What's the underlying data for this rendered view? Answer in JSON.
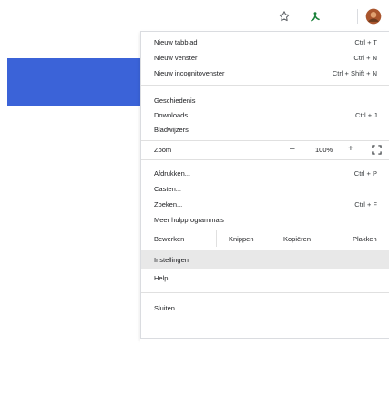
{
  "toolbar": {
    "star_icon": "star-icon",
    "extension_icon": "extension-icon",
    "avatar_icon": "avatar-icon"
  },
  "colors": {
    "accent": "#3b63d8",
    "highlight": "#e8e8e8"
  },
  "menu": {
    "new_tab": {
      "label": "Nieuw tabblad",
      "shortcut": "Ctrl + T"
    },
    "new_window": {
      "label": "Nieuw venster",
      "shortcut": "Ctrl + N"
    },
    "new_incognito": {
      "label": "Nieuw incognitovenster",
      "shortcut": "Ctrl + Shift + N"
    },
    "history": {
      "label": "Geschiedenis"
    },
    "downloads": {
      "label": "Downloads",
      "shortcut": "Ctrl + J"
    },
    "bookmarks": {
      "label": "Bladwijzers"
    },
    "zoom": {
      "label": "Zoom",
      "minus": "–",
      "value": "100%",
      "plus": "+"
    },
    "print": {
      "label": "Afdrukken...",
      "shortcut": "Ctrl + P"
    },
    "cast": {
      "label": "Casten..."
    },
    "find": {
      "label": "Zoeken...",
      "shortcut": "Ctrl + F"
    },
    "more_tools": {
      "label": "Meer hulpprogramma's"
    },
    "edit": {
      "label": "Bewerken",
      "cut": "Knippen",
      "copy": "Kopiëren",
      "paste": "Plakken"
    },
    "settings": {
      "label": "Instellingen"
    },
    "help": {
      "label": "Help"
    },
    "exit": {
      "label": "Sluiten"
    }
  }
}
